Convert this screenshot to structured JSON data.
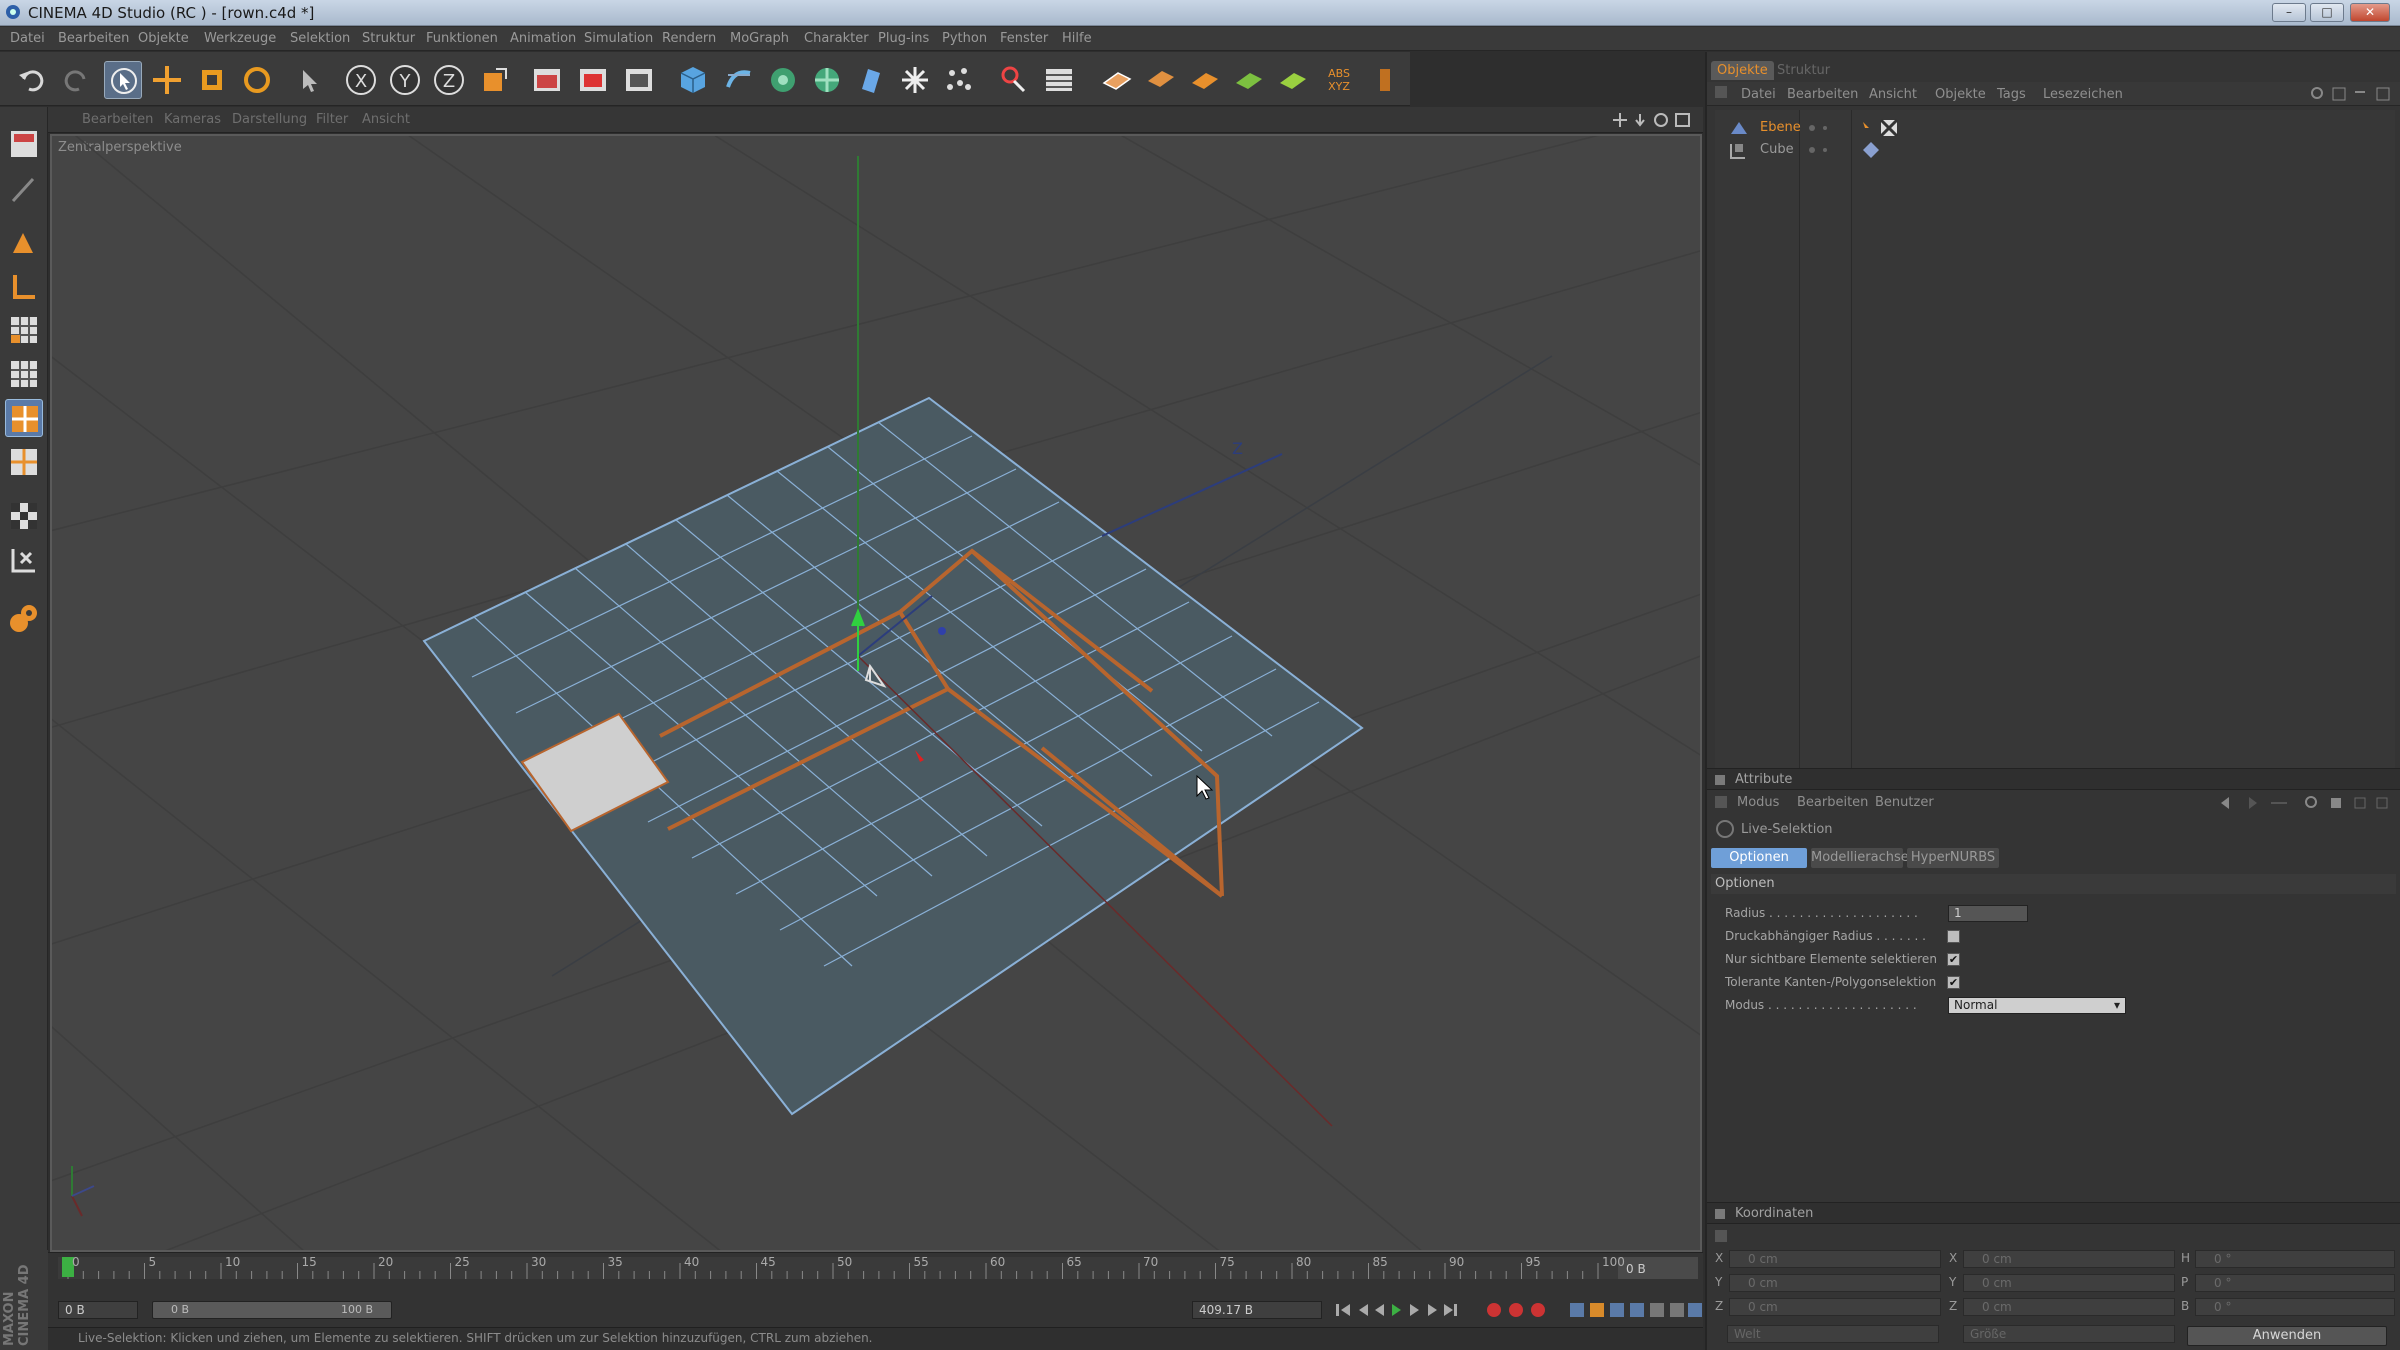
{
  "window": {
    "title": "CINEMA 4D Studio (RC ) - [rown.c4d *]",
    "controls": {
      "minimize": "–",
      "maximize": "□",
      "close": "✕"
    }
  },
  "menubar": [
    "Datei",
    "Bearbeiten",
    "Objekte",
    "Werkzeuge",
    "Selektion",
    "Struktur",
    "Funktionen",
    "Animation",
    "Simulation",
    "Rendern",
    "MoGraph",
    "Charakter",
    "Plug-ins",
    "Python",
    "Fenster",
    "Hilfe"
  ],
  "toolbar": {
    "icons": [
      "undo-icon",
      "redo-icon",
      "live-selection-icon",
      "move-icon",
      "scale-icon",
      "rotate-icon",
      "select-icon",
      "x-axis-icon",
      "y-axis-icon",
      "z-axis-icon",
      "coordinate-system-icon",
      "render-view-icon",
      "render-picture-viewer-icon",
      "render-settings-icon",
      "cube-icon",
      "nurbs-icon",
      "array-icon",
      "cloner-icon",
      "deformer-icon",
      "scene-icon",
      "particle-icon",
      "camera-icon",
      "light-icon",
      "edit-render-icon",
      "polygon-tool-icon",
      "edge-tool-icon",
      "point-tool-icon",
      "model-tool-icon",
      "texture-tool-icon",
      "abs-xyz-icon",
      "snap-icon"
    ],
    "abs_label": "ABS\nXYZ"
  },
  "viewport": {
    "menu": [
      "Bearbeiten",
      "Kameras",
      "Darstellung",
      "Filter",
      "Ansicht"
    ],
    "label": "Zentralperspektive",
    "nav_icons": [
      "move-view-icon",
      "zoom-view-icon",
      "rotate-view-icon",
      "maximize-view-icon"
    ]
  },
  "timeline": {
    "ticks": [
      "0",
      "5",
      "10",
      "15",
      "20",
      "25",
      "30",
      "35",
      "40",
      "45",
      "50",
      "55",
      "60",
      "65",
      "70",
      "75",
      "80",
      "85",
      "90",
      "95",
      "100"
    ],
    "current_frame": "0 B",
    "start_field": "0 B",
    "slider_left": "0 B",
    "slider_right": "100 B",
    "end_field": "409.17 B"
  },
  "status": "Live-Selektion: Klicken und ziehen, um Elemente zu selektieren. SHIFT drücken um zur Selektion hinzuzufügen, CTRL zum abziehen.",
  "maxon_logo": "MAXON\nCINEMA 4D",
  "object_manager": {
    "tabs": [
      "Objekte",
      "Struktur"
    ],
    "menu": [
      "Datei",
      "Bearbeiten",
      "Ansicht",
      "Objekte",
      "Tags",
      "Lesezeichen"
    ],
    "objects": [
      {
        "name": "Ebene",
        "selected": true
      },
      {
        "name": "Cube",
        "selected": false
      }
    ]
  },
  "attributes": {
    "title": "Attribute",
    "menu": [
      "Modus",
      "Bearbeiten",
      "Benutzer"
    ],
    "tool_name": "Live-Selektion",
    "tabs": [
      "Optionen",
      "Modellierachse",
      "HyperNURBS"
    ],
    "section": "Optionen",
    "rows": [
      {
        "label": "Radius . . . . . . . . . . . . . . . . . . . .",
        "type": "field",
        "value": "1"
      },
      {
        "label": "Druckabhängiger Radius . . . . . . .",
        "type": "check",
        "value": ""
      },
      {
        "label": "Nur sichtbare Elemente selektieren",
        "type": "check",
        "value": "✔"
      },
      {
        "label": "Tolerante Kanten-/Polygonselektion",
        "type": "check",
        "value": "✔"
      },
      {
        "label": "Modus . . . . . . . . . . . . . . . . . . . .",
        "type": "select",
        "value": "Normal"
      }
    ]
  },
  "coordinates": {
    "title": "Koordinaten",
    "rows": [
      {
        "a": "X",
        "b": "X",
        "c": "H",
        "va": "0 cm",
        "vb": "0 cm",
        "vc": "0 °"
      },
      {
        "a": "Y",
        "b": "Y",
        "c": "P",
        "va": "0 cm",
        "vb": "0 cm",
        "vc": "0 °"
      },
      {
        "a": "Z",
        "b": "Z",
        "c": "B",
        "va": "0 cm",
        "vb": "0 cm",
        "vc": "0 °"
      }
    ],
    "mode1": "Welt",
    "mode2": "Größe",
    "apply": "Anwenden"
  },
  "colors": {
    "accent": "#e8902c",
    "selected_tab": "#6f9fd8",
    "grid_plane": "#4a5a62",
    "grid_line": "#8ab0d6",
    "selected_edge": "#b8652e",
    "selected_poly": "#cfcfcf"
  }
}
